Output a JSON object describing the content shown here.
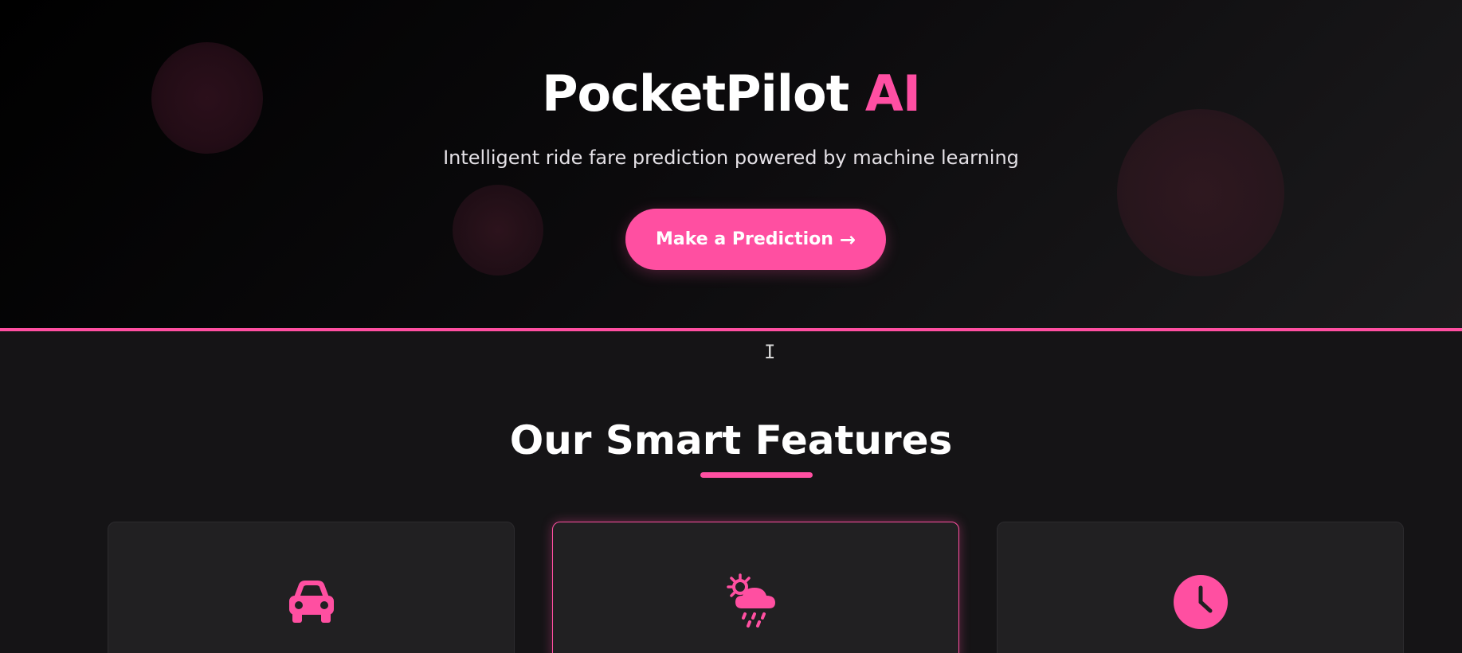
{
  "hero": {
    "title_main": "PocketPilot",
    "title_accent": "AI",
    "subtitle": "Intelligent ride fare prediction powered by machine learning",
    "cta_label": "Make a Prediction",
    "cta_arrow": "→"
  },
  "features": {
    "title": "Our Smart Features",
    "cards": [
      {
        "icon": "car-icon"
      },
      {
        "icon": "weather-sun-cloud-rain-icon",
        "highlighted": true
      },
      {
        "icon": "clock-icon"
      }
    ]
  },
  "colors": {
    "accent": "#ff4fa1",
    "background": "#151416",
    "card": "#212022",
    "text": "#ffffff"
  }
}
